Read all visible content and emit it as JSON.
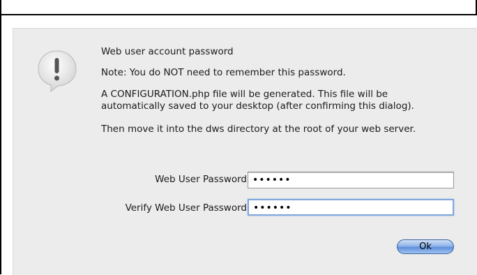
{
  "dialog": {
    "icon": "alert-icon",
    "heading": "Web user account password",
    "note": "Note: You do NOT need to remember this password.",
    "info_line1": "A CONFIGURATION.php file will be generated. This file will be",
    "info_line2": "automatically saved to your desktop (after confirming this dialog).",
    "instruction": "Then move it into the dws directory at the root of your web server.",
    "fields": [
      {
        "label": "Web User Password",
        "value": "••••••"
      },
      {
        "label": "Verify Web User Password",
        "value": "••••••"
      }
    ],
    "ok_label": "Ok"
  }
}
